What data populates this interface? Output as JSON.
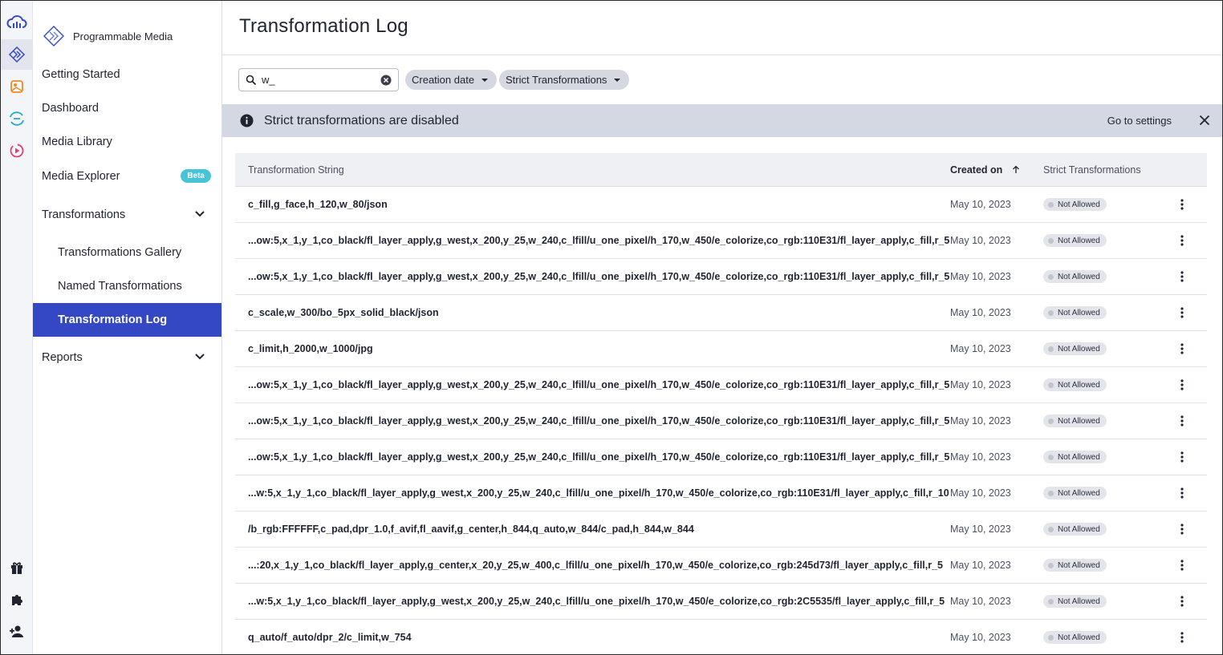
{
  "sidebar": {
    "brand": "Programmable Media",
    "items": {
      "getting_started": "Getting Started",
      "dashboard": "Dashboard",
      "media_library": "Media Library",
      "media_explorer": "Media Explorer",
      "media_explorer_badge": "Beta",
      "transformations": "Transformations",
      "transformations_gallery": "Transformations Gallery",
      "named_transformations": "Named Transformations",
      "transformation_log": "Transformation Log",
      "reports": "Reports"
    }
  },
  "header": {
    "title": "Transformation Log"
  },
  "filters": {
    "search_value": "w_",
    "creation_date": "Creation date",
    "strict_transformations": "Strict Transformations"
  },
  "banner": {
    "text": "Strict transformations are disabled",
    "link": "Go to settings"
  },
  "table": {
    "headers": {
      "string": "Transformation String",
      "created": "Created on",
      "strict": "Strict Transformations"
    },
    "rows": [
      {
        "string": "c_fill,g_face,h_120,w_80/json",
        "date": "May 10, 2023",
        "status": "Not Allowed"
      },
      {
        "string": "...ow:5,x_1,y_1,co_black/fl_layer_apply,g_west,x_200,y_25,w_240,c_lfill/u_one_pixel/h_170,w_450/e_colorize,co_rgb:110E31/fl_layer_apply,c_fill,r_5",
        "date": "May 10, 2023",
        "status": "Not Allowed"
      },
      {
        "string": "...ow:5,x_1,y_1,co_black/fl_layer_apply,g_west,x_200,y_25,w_240,c_lfill/u_one_pixel/h_170,w_450/e_colorize,co_rgb:110E31/fl_layer_apply,c_fill,r_5",
        "date": "May 10, 2023",
        "status": "Not Allowed"
      },
      {
        "string": "c_scale,w_300/bo_5px_solid_black/json",
        "date": "May 10, 2023",
        "status": "Not Allowed"
      },
      {
        "string": "c_limit,h_2000,w_1000/jpg",
        "date": "May 10, 2023",
        "status": "Not Allowed"
      },
      {
        "string": "...ow:5,x_1,y_1,co_black/fl_layer_apply,g_west,x_200,y_25,w_240,c_lfill/u_one_pixel/h_170,w_450/e_colorize,co_rgb:110E31/fl_layer_apply,c_fill,r_5",
        "date": "May 10, 2023",
        "status": "Not Allowed"
      },
      {
        "string": "...ow:5,x_1,y_1,co_black/fl_layer_apply,g_west,x_200,y_25,w_240,c_lfill/u_one_pixel/h_170,w_450/e_colorize,co_rgb:110E31/fl_layer_apply,c_fill,r_5",
        "date": "May 10, 2023",
        "status": "Not Allowed"
      },
      {
        "string": "...ow:5,x_1,y_1,co_black/fl_layer_apply,g_west,x_200,y_25,w_240,c_lfill/u_one_pixel/h_170,w_450/e_colorize,co_rgb:110E31/fl_layer_apply,c_fill,r_5",
        "date": "May 10, 2023",
        "status": "Not Allowed"
      },
      {
        "string": "...w:5,x_1,y_1,co_black/fl_layer_apply,g_west,x_200,y_25,w_240,c_lfill/u_one_pixel/h_170,w_450/e_colorize,co_rgb:110E31/fl_layer_apply,c_fill,r_10",
        "date": "May 10, 2023",
        "status": "Not Allowed"
      },
      {
        "string": "/b_rgb:FFFFFF,c_pad,dpr_1.0,f_avif,fl_aavif,g_center,h_844,q_auto,w_844/c_pad,h_844,w_844",
        "date": "May 10, 2023",
        "status": "Not Allowed"
      },
      {
        "string": "...:20,x_1,y_1,co_black/fl_layer_apply,g_center,x_20,y_25,w_400,c_lfill/u_one_pixel/h_170,w_450/e_colorize,co_rgb:245d73/fl_layer_apply,c_fill,r_5",
        "date": "May 10, 2023",
        "status": "Not Allowed"
      },
      {
        "string": "...w:5,x_1,y_1,co_black/fl_layer_apply,g_west,x_200,y_25,w_240,c_lfill/u_one_pixel/h_170,w_450/e_colorize,co_rgb:2C5535/fl_layer_apply,c_fill,r_5",
        "date": "May 10, 2023",
        "status": "Not Allowed"
      },
      {
        "string": "q_auto/f_auto/dpr_2/c_limit,w_754",
        "date": "May 10, 2023",
        "status": "Not Allowed"
      }
    ]
  }
}
